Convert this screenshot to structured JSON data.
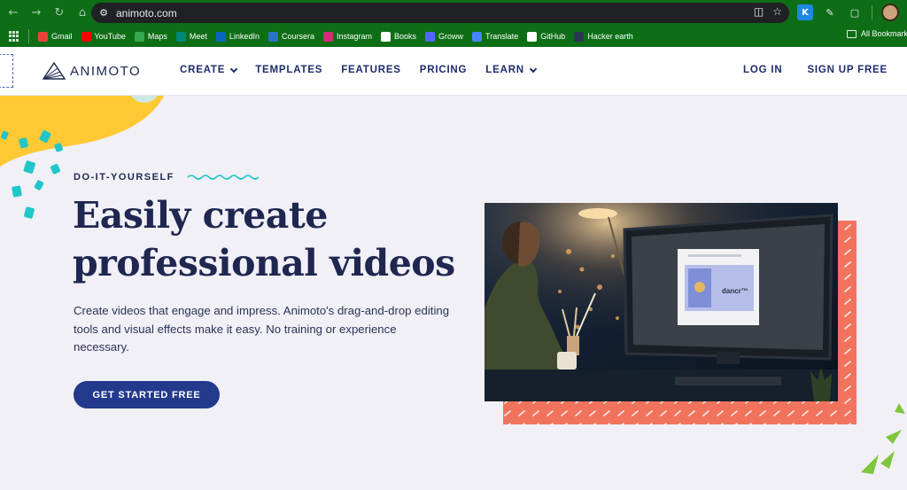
{
  "browser": {
    "url": "animoto.com",
    "bookmarks": [
      {
        "label": "Gmail",
        "color": "#ea4335"
      },
      {
        "label": "YouTube",
        "color": "#ff0000"
      },
      {
        "label": "Maps",
        "color": "#34a853"
      },
      {
        "label": "Meet",
        "color": "#00897b"
      },
      {
        "label": "LinkedIn",
        "color": "#0a66c2"
      },
      {
        "label": "Coursera",
        "color": "#2a73cc"
      },
      {
        "label": "Instagram",
        "color": "#d62976"
      },
      {
        "label": "Books",
        "color": "#ffffff"
      },
      {
        "label": "Groww",
        "color": "#5367ff"
      },
      {
        "label": "Translate",
        "color": "#4285f4"
      },
      {
        "label": "GitHub",
        "color": "#ffffff"
      },
      {
        "label": "Hacker earth",
        "color": "#2c3454"
      }
    ],
    "all_bookmarks_label": "All Bookmarks"
  },
  "header": {
    "logo_text": "ANIMOTO",
    "nav": [
      {
        "label": "CREATE",
        "has_dropdown": true
      },
      {
        "label": "TEMPLATES",
        "has_dropdown": false
      },
      {
        "label": "FEATURES",
        "has_dropdown": false
      },
      {
        "label": "PRICING",
        "has_dropdown": false
      },
      {
        "label": "LEARN",
        "has_dropdown": true
      }
    ],
    "login_label": "LOG IN",
    "signup_label": "SIGN UP FREE"
  },
  "hero": {
    "eyebrow": "DO-IT-YOURSELF",
    "headline_line1": "Easily create",
    "headline_line2": "professional videos",
    "subtext": "Create videos that engage and impress. Animoto's drag-and-drop editing tools and visual effects make it easy. No training or experience necessary.",
    "cta_label": "GET STARTED FREE",
    "video_screen_text": "dancr™"
  },
  "colors": {
    "brand_navy": "#1f2750",
    "cta_blue": "#22398c",
    "coral": "#f2735d",
    "yellow": "#ffc933",
    "teal": "#21c6c8",
    "browser_green": "#0e6e16"
  }
}
